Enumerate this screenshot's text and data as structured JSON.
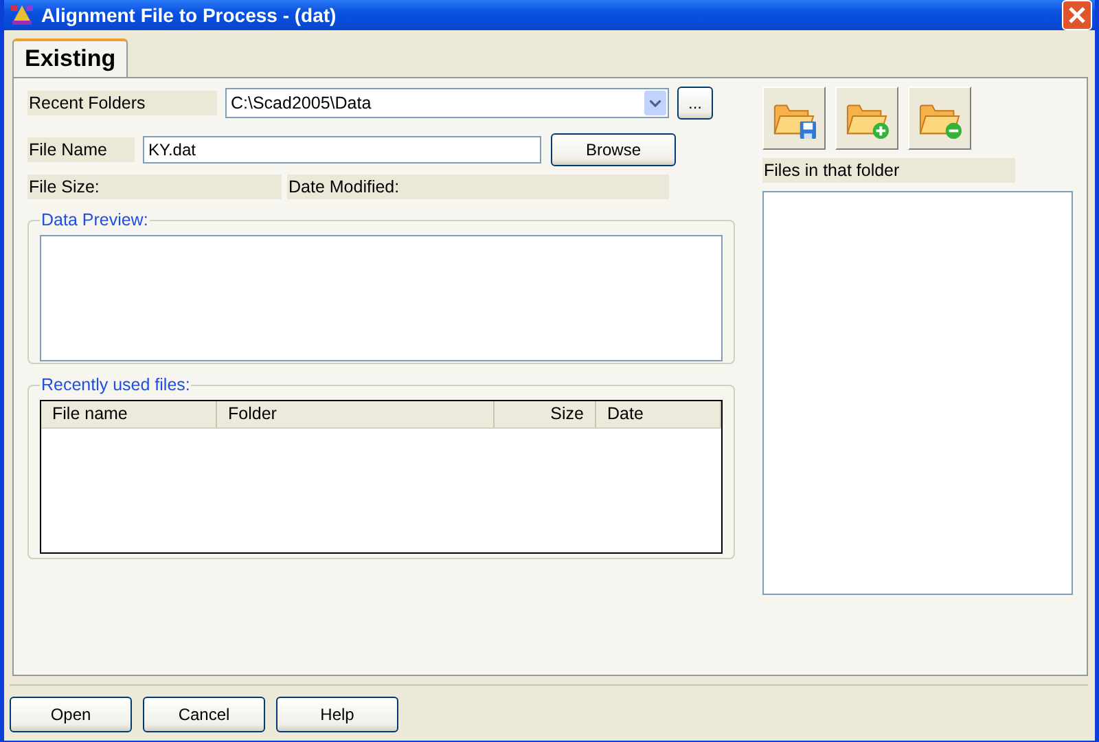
{
  "window": {
    "title": "Alignment File to Process - (dat)"
  },
  "tabs": [
    {
      "label": "Existing",
      "selected": true
    }
  ],
  "recent_folders": {
    "label": "Recent Folders",
    "value": "C:\\Scad2005\\Data",
    "more_button": "..."
  },
  "file_name": {
    "label": "File Name",
    "value": "KY.dat",
    "button": "Browse"
  },
  "file_size": {
    "label": "File Size:"
  },
  "date_modified": {
    "label": "Date Modified:"
  },
  "data_preview": {
    "title": "Data Preview:"
  },
  "recent_files": {
    "title": "Recently used files:",
    "columns": [
      "File name",
      "Folder",
      "Size",
      "Date"
    ]
  },
  "folder_tools": [
    {
      "kind": "save"
    },
    {
      "kind": "add"
    },
    {
      "kind": "remove"
    }
  ],
  "files_panel": {
    "label": "Files in that folder"
  },
  "buttons": [
    "Open",
    "Cancel",
    "Help"
  ]
}
